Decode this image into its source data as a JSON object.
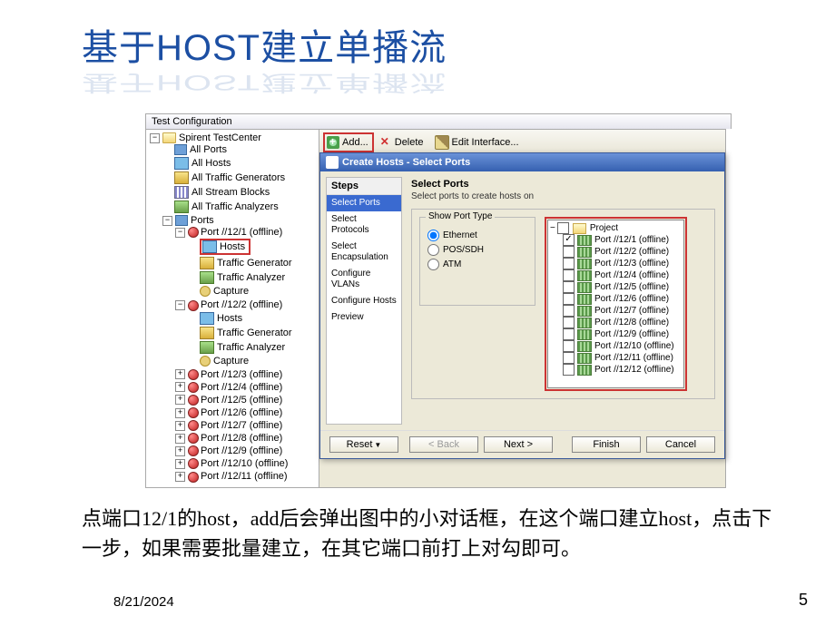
{
  "slide": {
    "title": "基于HOST建立单播流",
    "caption": "点端口12/1的host，add后会弹出图中的小对话框，在这个端口建立host，点击下一步，如果需要批量建立，在其它端口前打上对勾即可。",
    "date": "8/21/2024",
    "page": "5"
  },
  "panel_title": "Test Configuration",
  "tree": {
    "root": "Spirent TestCenter",
    "items": [
      "All Ports",
      "All Hosts",
      "All Traffic Generators",
      "All Stream Blocks",
      "All Traffic Analyzers",
      "Ports"
    ],
    "port1": "Port //12/1 (offline)",
    "port1_children": [
      "Hosts",
      "Traffic Generator",
      "Traffic Analyzer",
      "Capture"
    ],
    "port2": "Port //12/2 (offline)",
    "port2_children": [
      "Hosts",
      "Traffic Generator",
      "Traffic Analyzer",
      "Capture"
    ],
    "rest": [
      "Port //12/3 (offline)",
      "Port //12/4 (offline)",
      "Port //12/5 (offline)",
      "Port //12/6 (offline)",
      "Port //12/7 (offline)",
      "Port //12/8 (offline)",
      "Port //12/9 (offline)",
      "Port //12/10 (offline)",
      "Port //12/11 (offline)"
    ]
  },
  "toolbar": {
    "add": "Add...",
    "delete": "Delete",
    "edit": "Edit Interface..."
  },
  "dialog": {
    "title": "Create Hosts - Select Ports",
    "steps_header": "Steps",
    "steps": [
      "Select Ports",
      "Select Protocols",
      "Select Encapsulation",
      "Configure VLANs",
      "Configure Hosts",
      "Preview"
    ],
    "heading": "Select Ports",
    "sub": "Select ports to create hosts on",
    "group": "Show Port Type",
    "radios": [
      "Ethernet",
      "POS/SDH",
      "ATM"
    ],
    "proj_label": "Project",
    "ports": [
      {
        "label": "Port //12/1 (offline)",
        "checked": true
      },
      {
        "label": "Port //12/2 (offline)",
        "checked": false
      },
      {
        "label": "Port //12/3 (offline)",
        "checked": false
      },
      {
        "label": "Port //12/4 (offline)",
        "checked": false
      },
      {
        "label": "Port //12/5 (offline)",
        "checked": false
      },
      {
        "label": "Port //12/6 (offline)",
        "checked": false
      },
      {
        "label": "Port //12/7 (offline)",
        "checked": false
      },
      {
        "label": "Port //12/8 (offline)",
        "checked": false
      },
      {
        "label": "Port //12/9 (offline)",
        "checked": false
      },
      {
        "label": "Port //12/10 (offline)",
        "checked": false
      },
      {
        "label": "Port //12/11 (offline)",
        "checked": false
      },
      {
        "label": "Port //12/12 (offline)",
        "checked": false
      }
    ],
    "buttons": {
      "reset": "Reset",
      "back": "< Back",
      "next": "Next >",
      "finish": "Finish",
      "cancel": "Cancel"
    }
  }
}
